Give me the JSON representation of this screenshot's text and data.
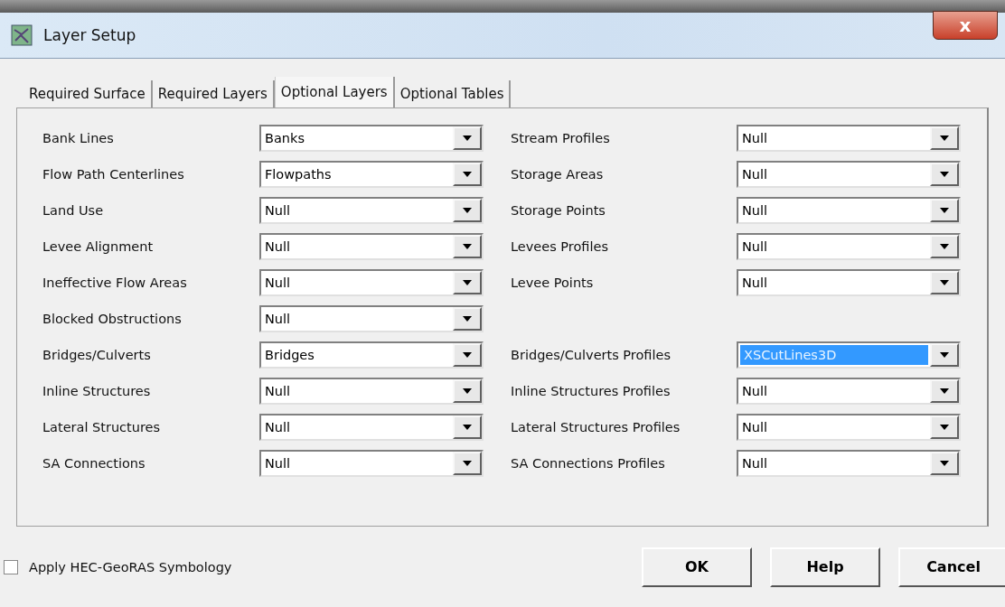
{
  "window": {
    "title": "Layer Setup",
    "close": "x"
  },
  "tabs": [
    {
      "label": "Required Surface",
      "selected": false
    },
    {
      "label": "Required Layers",
      "selected": false
    },
    {
      "label": "Optional Layers",
      "selected": true
    },
    {
      "label": "Optional Tables",
      "selected": false
    }
  ],
  "rows": [
    {
      "left": {
        "label": "Bank Lines",
        "value": "Banks",
        "focused": false
      },
      "right": {
        "label": "Stream Profiles",
        "value": "Null",
        "focused": false
      }
    },
    {
      "left": {
        "label": "Flow Path Centerlines",
        "value": "Flowpaths",
        "focused": false
      },
      "right": {
        "label": "Storage Areas",
        "value": "Null",
        "focused": false
      }
    },
    {
      "left": {
        "label": "Land Use",
        "value": "Null",
        "focused": false
      },
      "right": {
        "label": "Storage Points",
        "value": "Null",
        "focused": false
      }
    },
    {
      "left": {
        "label": "Levee Alignment",
        "value": "Null",
        "focused": false
      },
      "right": {
        "label": "Levees Profiles",
        "value": "Null",
        "focused": false
      }
    },
    {
      "left": {
        "label": "Ineffective Flow Areas",
        "value": "Null",
        "focused": false
      },
      "right": {
        "label": "Levee Points",
        "value": "Null",
        "focused": false
      }
    },
    {
      "left": {
        "label": "Blocked Obstructions",
        "value": "Null",
        "focused": false
      }
    },
    {
      "left": {
        "label": "Bridges/Culverts",
        "value": "Bridges",
        "focused": false
      },
      "right": {
        "label": "Bridges/Culverts Profiles",
        "value": "XSCutLines3D",
        "focused": true
      }
    },
    {
      "left": {
        "label": "Inline Structures",
        "value": "Null",
        "focused": false
      },
      "right": {
        "label": "Inline Structures Profiles",
        "value": "Null",
        "focused": false
      }
    },
    {
      "left": {
        "label": "Lateral Structures",
        "value": "Null",
        "focused": false
      },
      "right": {
        "label": "Lateral Structures Profiles",
        "value": "Null",
        "focused": false
      }
    },
    {
      "left": {
        "label": "SA Connections",
        "value": "Null",
        "focused": false
      },
      "right": {
        "label": "SA Connections Profiles",
        "value": "Null",
        "focused": false
      }
    }
  ],
  "symbology": {
    "label": "Apply HEC-GeoRAS Symbology",
    "checked": false
  },
  "buttons": [
    "OK",
    "Help",
    "Cancel"
  ]
}
